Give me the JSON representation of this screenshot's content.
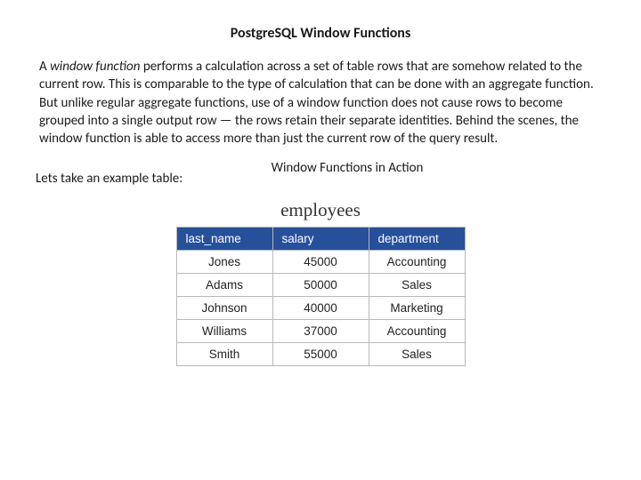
{
  "title": "PostgreSQL Window Functions",
  "intro": {
    "prefix": "A ",
    "em": "window function",
    "rest": " performs a calculation across a set of table rows that are somehow related to the current row. This is comparable to the type of calculation that can be done with an aggregate function. But unlike regular aggregate functions, use of a window function does not cause rows to become grouped into a single output row — the rows retain their separate identities. Behind the scenes, the window function is able to access more than just the current row of the query result."
  },
  "section_title": "Window Functions in Action",
  "lead_in": "Lets take an example table:",
  "table": {
    "caption": "employees",
    "columns": [
      "last_name",
      "salary",
      "department"
    ],
    "rows": [
      {
        "last_name": "Jones",
        "salary": "45000",
        "department": "Accounting"
      },
      {
        "last_name": "Adams",
        "salary": "50000",
        "department": "Sales"
      },
      {
        "last_name": "Johnson",
        "salary": "40000",
        "department": "Marketing"
      },
      {
        "last_name": "Williams",
        "salary": "37000",
        "department": "Accounting"
      },
      {
        "last_name": "Smith",
        "salary": "55000",
        "department": "Sales"
      }
    ]
  }
}
